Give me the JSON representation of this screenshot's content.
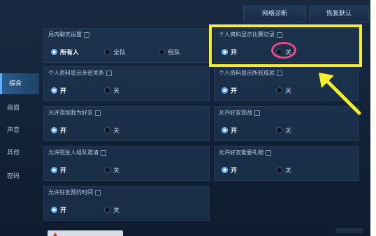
{
  "topbar": {
    "network_diag": "网络诊断",
    "reset_default": "恢复默认"
  },
  "sidebar": {
    "items": [
      {
        "label": "综合",
        "active": true
      },
      {
        "label": "画面",
        "active": false
      },
      {
        "label": "声音",
        "active": false
      },
      {
        "label": "其他",
        "active": false
      },
      {
        "label": "密码",
        "active": false
      }
    ]
  },
  "settings": {
    "chat_setting": {
      "title": "局内聊天设置",
      "opt1": "所有人",
      "opt2": "全队",
      "opt3": "组队"
    },
    "show_match_record": {
      "title": "个人资料显示比赛记录",
      "on": "开",
      "off": "关"
    },
    "show_intimacy": {
      "title": "个人资料显示亲密关系",
      "on": "开",
      "off": "关"
    },
    "show_achievements": {
      "title": "个人资料显示所获成就",
      "on": "开",
      "off": "关"
    },
    "allow_add_friend": {
      "title": "允许添加我为好友",
      "on": "开",
      "off": "关"
    },
    "allow_friend_watch": {
      "title": "允许好友观战",
      "on": "开",
      "off": "关"
    },
    "allow_stranger_invite": {
      "title": "允许陌生人组队邀请",
      "on": "开",
      "off": "关"
    },
    "allow_friend_gift": {
      "title": "允许好友索要礼物",
      "on": "开",
      "off": "关"
    },
    "allow_friend_reserve": {
      "title": "允许好友预约时间",
      "on": "开",
      "off": "关"
    }
  },
  "annotation": {
    "highlight_color": "#f4ee2b",
    "ring_color": "#e84b86"
  }
}
